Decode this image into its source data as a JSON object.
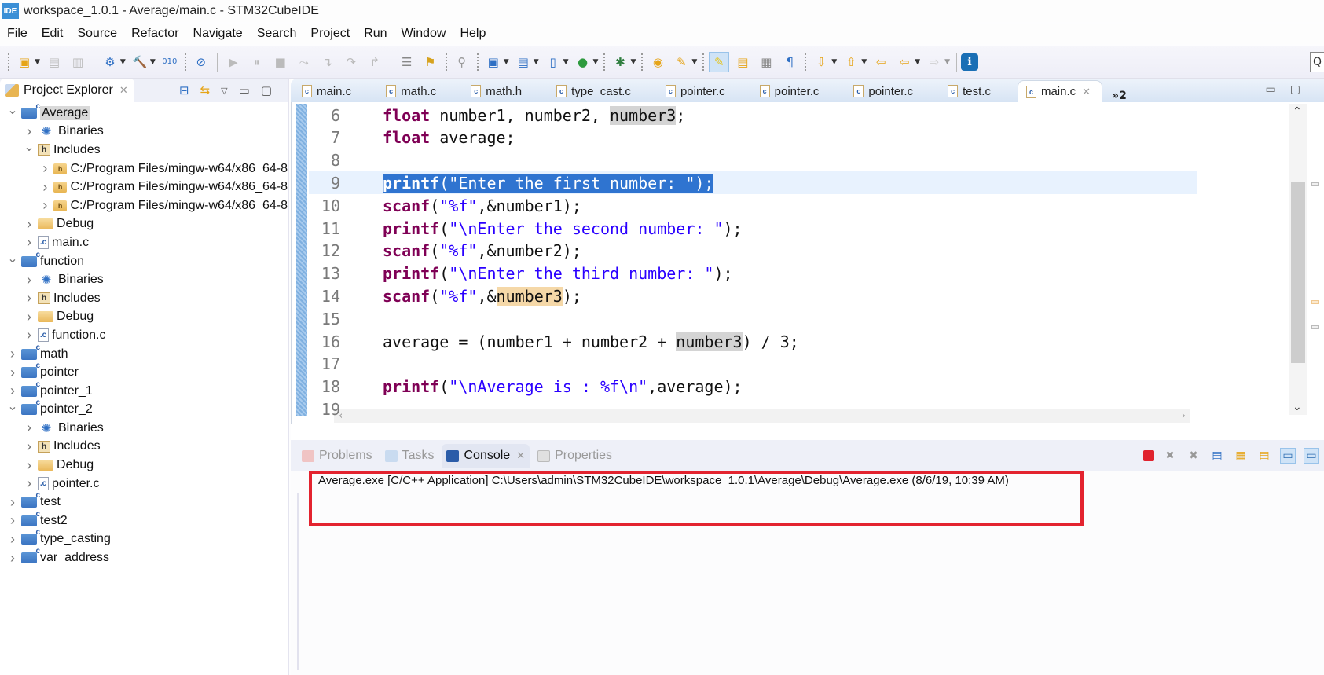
{
  "window": {
    "app_icon": "IDE",
    "title": "workspace_1.0.1 - Average/main.c - STM32CubeIDE"
  },
  "menu": [
    "File",
    "Edit",
    "Source",
    "Refactor",
    "Navigate",
    "Search",
    "Project",
    "Run",
    "Window",
    "Help"
  ],
  "toolbar": {
    "quick_access_icon": "Q"
  },
  "project_explorer": {
    "title": "Project Explorer",
    "tree": [
      {
        "level": 0,
        "expanded": true,
        "type": "project",
        "label": "Average",
        "selected": true
      },
      {
        "level": 1,
        "expanded": false,
        "type": "binaries",
        "label": "Binaries"
      },
      {
        "level": 1,
        "expanded": true,
        "type": "includes",
        "label": "Includes"
      },
      {
        "level": 2,
        "expanded": false,
        "type": "include-dir",
        "label": "C:/Program Files/mingw-w64/x86_64-8"
      },
      {
        "level": 2,
        "expanded": false,
        "type": "include-dir",
        "label": "C:/Program Files/mingw-w64/x86_64-8"
      },
      {
        "level": 2,
        "expanded": false,
        "type": "include-dir",
        "label": "C:/Program Files/mingw-w64/x86_64-8"
      },
      {
        "level": 1,
        "expanded": false,
        "type": "folder",
        "label": "Debug"
      },
      {
        "level": 1,
        "expanded": false,
        "type": "cfile",
        "label": "main.c"
      },
      {
        "level": 0,
        "expanded": true,
        "type": "project",
        "label": "function"
      },
      {
        "level": 1,
        "expanded": false,
        "type": "binaries",
        "label": "Binaries"
      },
      {
        "level": 1,
        "expanded": false,
        "type": "includes",
        "label": "Includes"
      },
      {
        "level": 1,
        "expanded": false,
        "type": "folder",
        "label": "Debug"
      },
      {
        "level": 1,
        "expanded": false,
        "type": "cfile",
        "label": "function.c"
      },
      {
        "level": 0,
        "expanded": false,
        "type": "project",
        "label": "math"
      },
      {
        "level": 0,
        "expanded": false,
        "type": "project",
        "label": "pointer"
      },
      {
        "level": 0,
        "expanded": false,
        "type": "project",
        "label": "pointer_1"
      },
      {
        "level": 0,
        "expanded": true,
        "type": "project",
        "label": "pointer_2"
      },
      {
        "level": 1,
        "expanded": false,
        "type": "binaries",
        "label": "Binaries"
      },
      {
        "level": 1,
        "expanded": false,
        "type": "includes",
        "label": "Includes"
      },
      {
        "level": 1,
        "expanded": false,
        "type": "folder",
        "label": "Debug"
      },
      {
        "level": 1,
        "expanded": false,
        "type": "cfile",
        "label": "pointer.c"
      },
      {
        "level": 0,
        "expanded": false,
        "type": "project",
        "label": "test"
      },
      {
        "level": 0,
        "expanded": false,
        "type": "project",
        "label": "test2"
      },
      {
        "level": 0,
        "expanded": false,
        "type": "project",
        "label": "type_casting"
      },
      {
        "level": 0,
        "expanded": false,
        "type": "project",
        "label": "var_address"
      }
    ]
  },
  "editor": {
    "tabs": [
      {
        "label": "main.c",
        "active": false
      },
      {
        "label": "math.c",
        "active": false
      },
      {
        "label": "math.h",
        "active": false
      },
      {
        "label": "type_cast.c",
        "active": false
      },
      {
        "label": "pointer.c",
        "active": false
      },
      {
        "label": "pointer.c",
        "active": false
      },
      {
        "label": "pointer.c",
        "active": false
      },
      {
        "label": "test.c",
        "active": false
      },
      {
        "label": "main.c",
        "active": true
      }
    ],
    "overflow_label": "»2",
    "lines": [
      {
        "no": "6",
        "text": "float number1, number2, number3;"
      },
      {
        "no": "7",
        "text": "float average;"
      },
      {
        "no": "8",
        "text": ""
      },
      {
        "no": "9",
        "text": "printf(\"Enter the first number: \");",
        "selected": true
      },
      {
        "no": "10",
        "text": "scanf(\"%f\",&number1);"
      },
      {
        "no": "11",
        "text": "printf(\"\\nEnter the second number: \");"
      },
      {
        "no": "12",
        "text": "scanf(\"%f\",&number2);"
      },
      {
        "no": "13",
        "text": "printf(\"\\nEnter the third number: \");"
      },
      {
        "no": "14",
        "text": "scanf(\"%f\",&number3);"
      },
      {
        "no": "15",
        "text": ""
      },
      {
        "no": "16",
        "text": "average = (number1 + number2 + number3) / 3;"
      },
      {
        "no": "17",
        "text": ""
      },
      {
        "no": "18",
        "text": "printf(\"\\nAverage is : %f\\n\",average);"
      },
      {
        "no": "19",
        "text": ""
      }
    ]
  },
  "console": {
    "tabs": [
      {
        "label": "Problems",
        "active": false
      },
      {
        "label": "Tasks",
        "active": false
      },
      {
        "label": "Console",
        "active": true
      },
      {
        "label": "Properties",
        "active": false
      }
    ],
    "process_label": "Average.exe [C/C++ Application] C:\\Users\\admin\\STM32CubeIDE\\workspace_1.0.1\\Average\\Debug\\Average.exe (8/6/19, 10:39 AM)",
    "highlight_color": "#e3232f"
  }
}
